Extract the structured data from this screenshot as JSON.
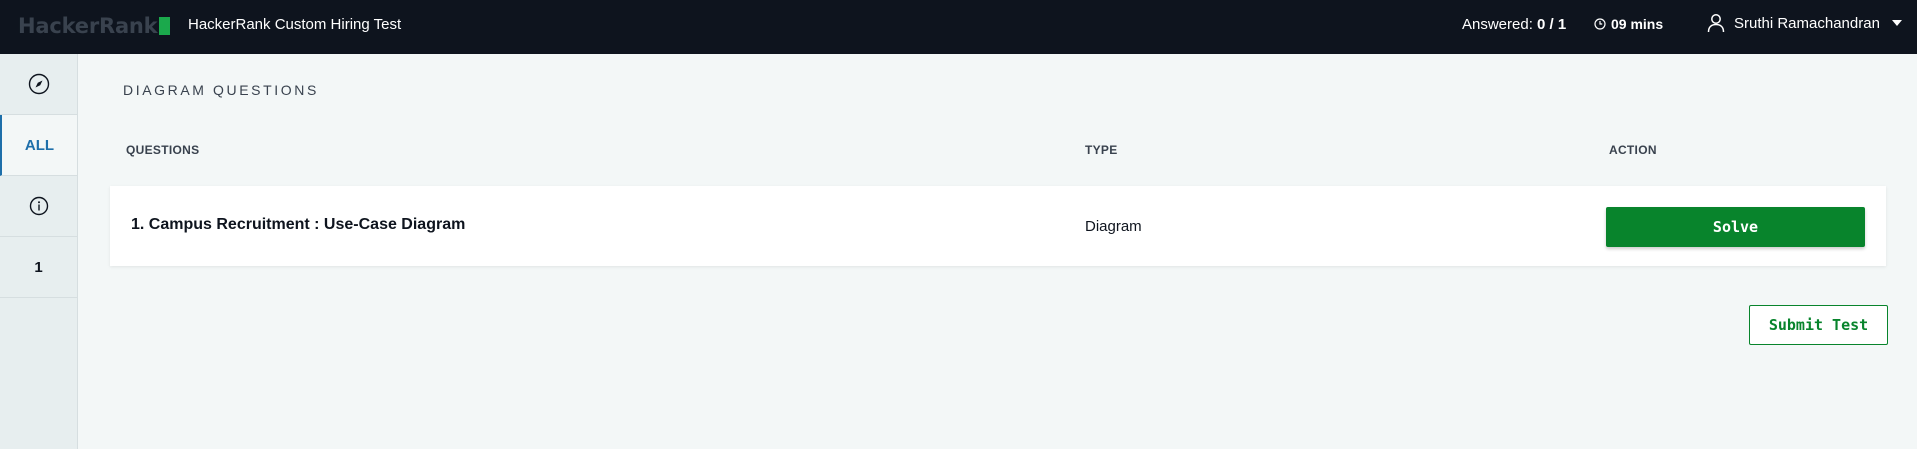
{
  "header": {
    "logo_text": "HackerRank",
    "test_title": "HackerRank Custom Hiring Test",
    "answered_label": "Answered:",
    "answered_value": "0 / 1",
    "timer": "09 mins",
    "user_name": "Sruthi Ramachandran",
    "icons": [
      "clock-icon",
      "user-icon",
      "caret-down-icon"
    ]
  },
  "sidebar": {
    "items": [
      {
        "type": "icon",
        "icon": "compass-icon"
      },
      {
        "type": "text",
        "label": "ALL",
        "active": true
      },
      {
        "type": "icon",
        "icon": "info-icon"
      },
      {
        "type": "text",
        "label": "1"
      }
    ]
  },
  "main": {
    "section_title": "DIAGRAM QUESTIONS",
    "columns": [
      "QUESTIONS",
      "TYPE",
      "ACTION"
    ],
    "rows": [
      {
        "question": "1. Campus Recruitment : Use-Case Diagram",
        "type": "Diagram",
        "action": "Solve"
      }
    ],
    "submit_label": "Submit Test"
  },
  "colors": {
    "topbar": "#0e141e",
    "accent_green": "#08842c",
    "active_blue": "#1e6faa",
    "logo_green": "#1ba94c"
  }
}
